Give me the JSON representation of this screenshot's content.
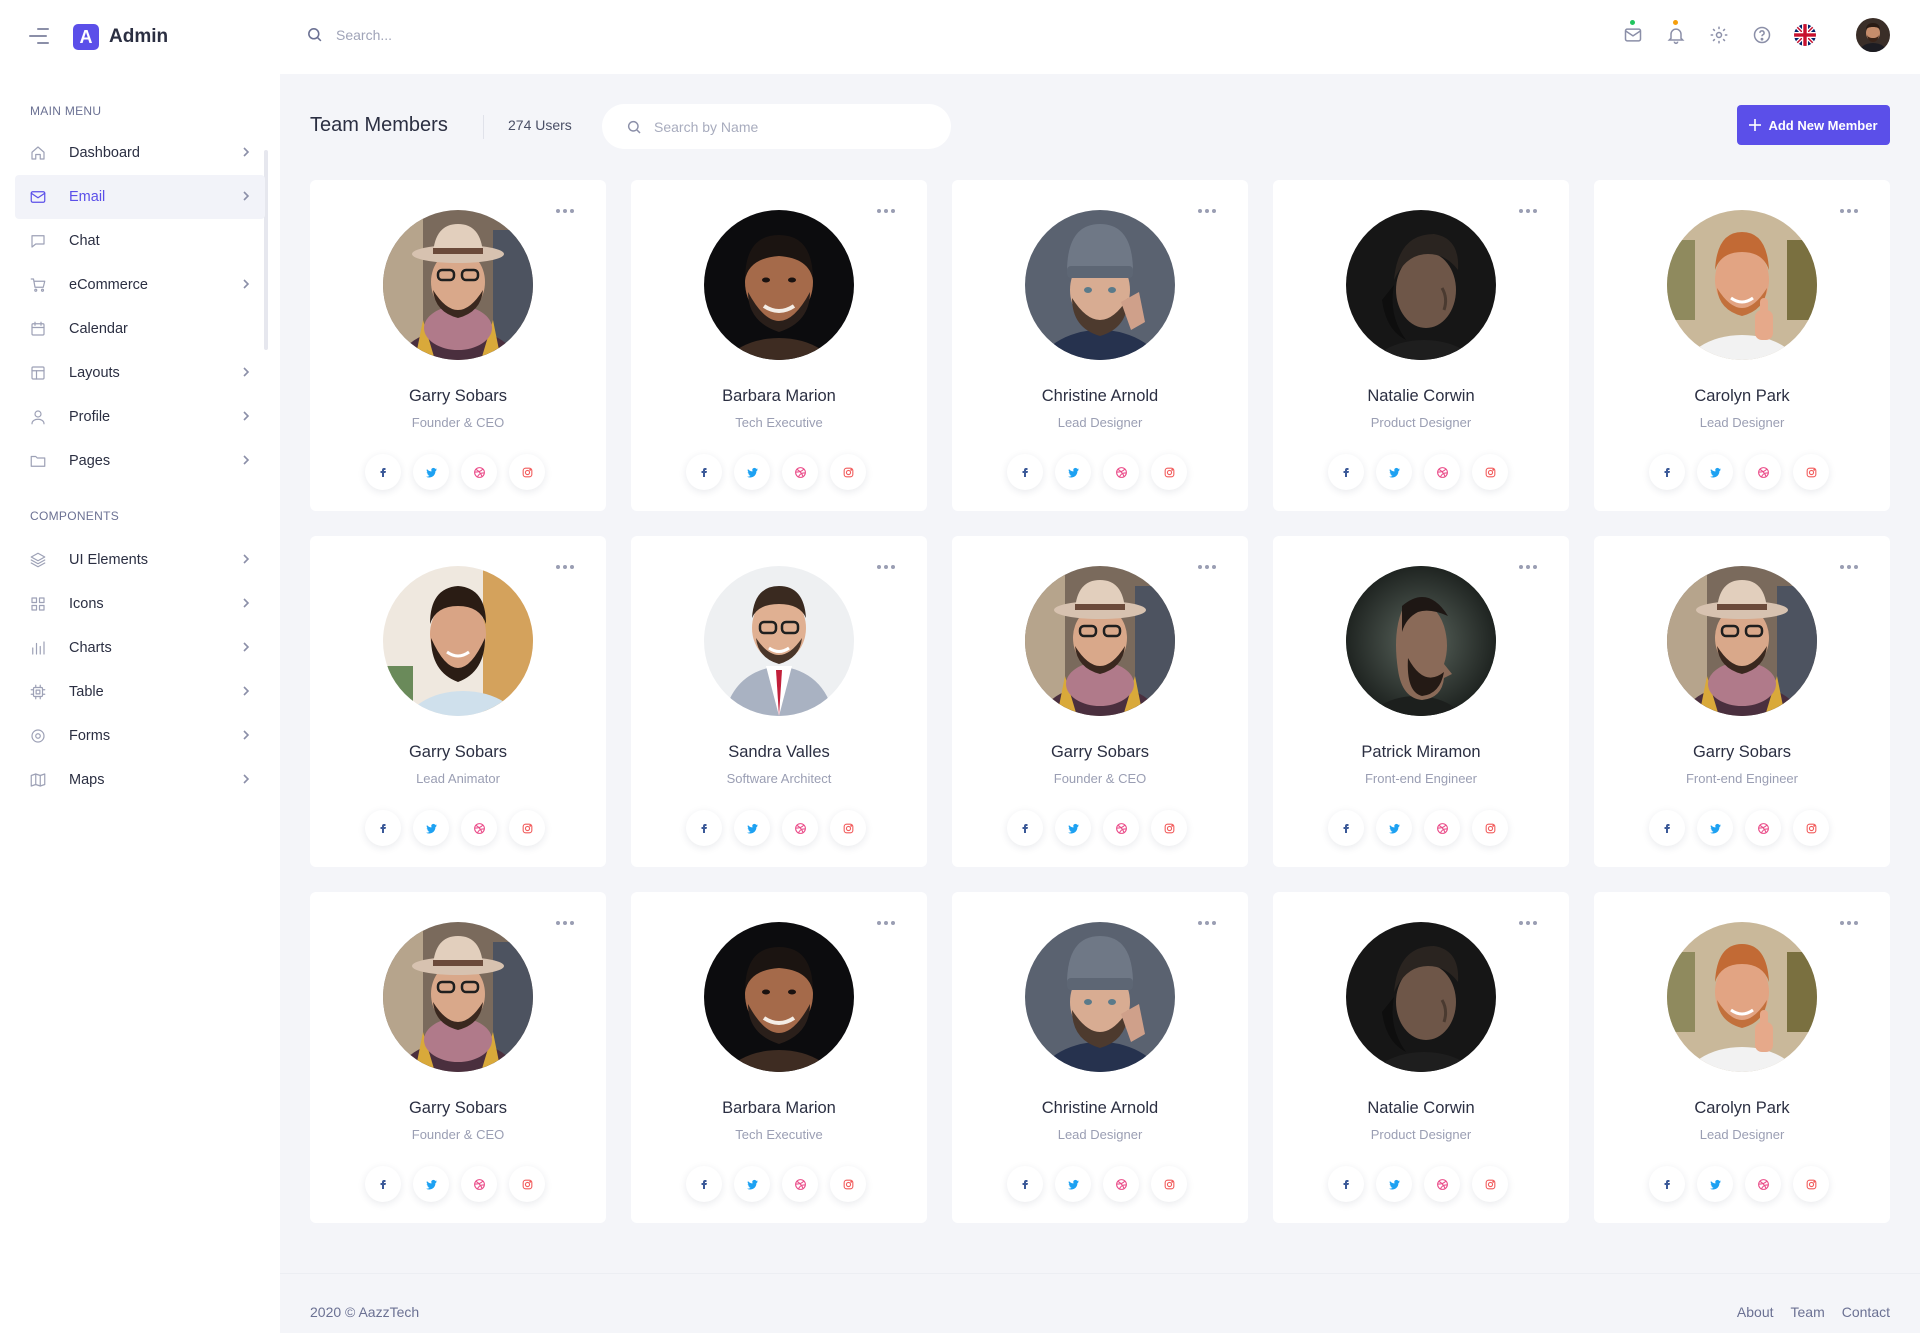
{
  "app": {
    "logo_letter": "A",
    "name": "Admin"
  },
  "topbar": {
    "search_placeholder": "Search...",
    "icons": [
      "mail-icon",
      "bell-icon",
      "gear-icon",
      "help-icon",
      "uk-flag-icon"
    ],
    "mail_dot_color": "#22c55e",
    "bell_dot_color": "#f59e0b"
  },
  "sidebar": {
    "main_menu_label": "MAIN MENU",
    "components_label": "COMPONENTS",
    "main_items": [
      {
        "label": "Dashboard",
        "icon": "home-icon",
        "chevron": true
      },
      {
        "label": "Email",
        "icon": "mail-icon",
        "chevron": true,
        "active": true
      },
      {
        "label": "Chat",
        "icon": "chat-icon",
        "chevron": false
      },
      {
        "label": "eCommerce",
        "icon": "cart-icon",
        "chevron": true
      },
      {
        "label": "Calendar",
        "icon": "calendar-icon",
        "chevron": false
      },
      {
        "label": "Layouts",
        "icon": "layout-icon",
        "chevron": true
      },
      {
        "label": "Profile",
        "icon": "user-icon",
        "chevron": true
      },
      {
        "label": "Pages",
        "icon": "folder-icon",
        "chevron": true
      }
    ],
    "component_items": [
      {
        "label": "UI Elements",
        "icon": "layers-icon",
        "chevron": true
      },
      {
        "label": "Icons",
        "icon": "grid-icon",
        "chevron": true
      },
      {
        "label": "Charts",
        "icon": "bar-chart-icon",
        "chevron": true
      },
      {
        "label": "Table",
        "icon": "chip-icon",
        "chevron": true
      },
      {
        "label": "Forms",
        "icon": "target-icon",
        "chevron": true
      },
      {
        "label": "Maps",
        "icon": "map-icon",
        "chevron": true
      }
    ]
  },
  "main": {
    "title": "Team Members",
    "user_count": "274 Users",
    "search_placeholder": "Search by Name",
    "add_button": "Add New Member",
    "accent": "#5b4fe9"
  },
  "members": [
    {
      "name": "Garry Sobars",
      "role": "Founder & CEO",
      "portrait": "hat-scarf"
    },
    {
      "name": "Barbara Marion",
      "role": "Tech Executive",
      "portrait": "dark-smile"
    },
    {
      "name": "Christine Arnold",
      "role": "Lead Designer",
      "portrait": "beanie"
    },
    {
      "name": "Natalie Corwin",
      "role": "Product Designer",
      "portrait": "shadow-profile"
    },
    {
      "name": "Carolyn Park",
      "role": "Lead Designer",
      "portrait": "ginger-thumbs"
    },
    {
      "name": "Garry Sobars",
      "role": "Lead Animator",
      "portrait": "bearded-light"
    },
    {
      "name": "Sandra Valles",
      "role": "Software Architect",
      "portrait": "suit-glasses"
    },
    {
      "name": "Garry Sobars",
      "role": "Founder & CEO",
      "portrait": "hat-scarf"
    },
    {
      "name": "Patrick Miramon",
      "role": "Front-end Engineer",
      "portrait": "side-profile"
    },
    {
      "name": "Garry Sobars",
      "role": "Front-end Engineer",
      "portrait": "hat-scarf"
    },
    {
      "name": "Garry Sobars",
      "role": "Founder & CEO",
      "portrait": "hat-scarf"
    },
    {
      "name": "Barbara Marion",
      "role": "Tech Executive",
      "portrait": "dark-smile"
    },
    {
      "name": "Christine Arnold",
      "role": "Lead Designer",
      "portrait": "beanie"
    },
    {
      "name": "Natalie Corwin",
      "role": "Product Designer",
      "portrait": "shadow-profile"
    },
    {
      "name": "Carolyn Park",
      "role": "Lead Designer",
      "portrait": "ginger-thumbs"
    }
  ],
  "social_colors": {
    "facebook": "#3b5998",
    "twitter": "#1da1f2",
    "dribbble": "#ea4c89",
    "instagram": "#f15b5b"
  },
  "footer": {
    "copyright": "2020 © AazzTech",
    "links": [
      "About",
      "Team",
      "Contact"
    ]
  }
}
